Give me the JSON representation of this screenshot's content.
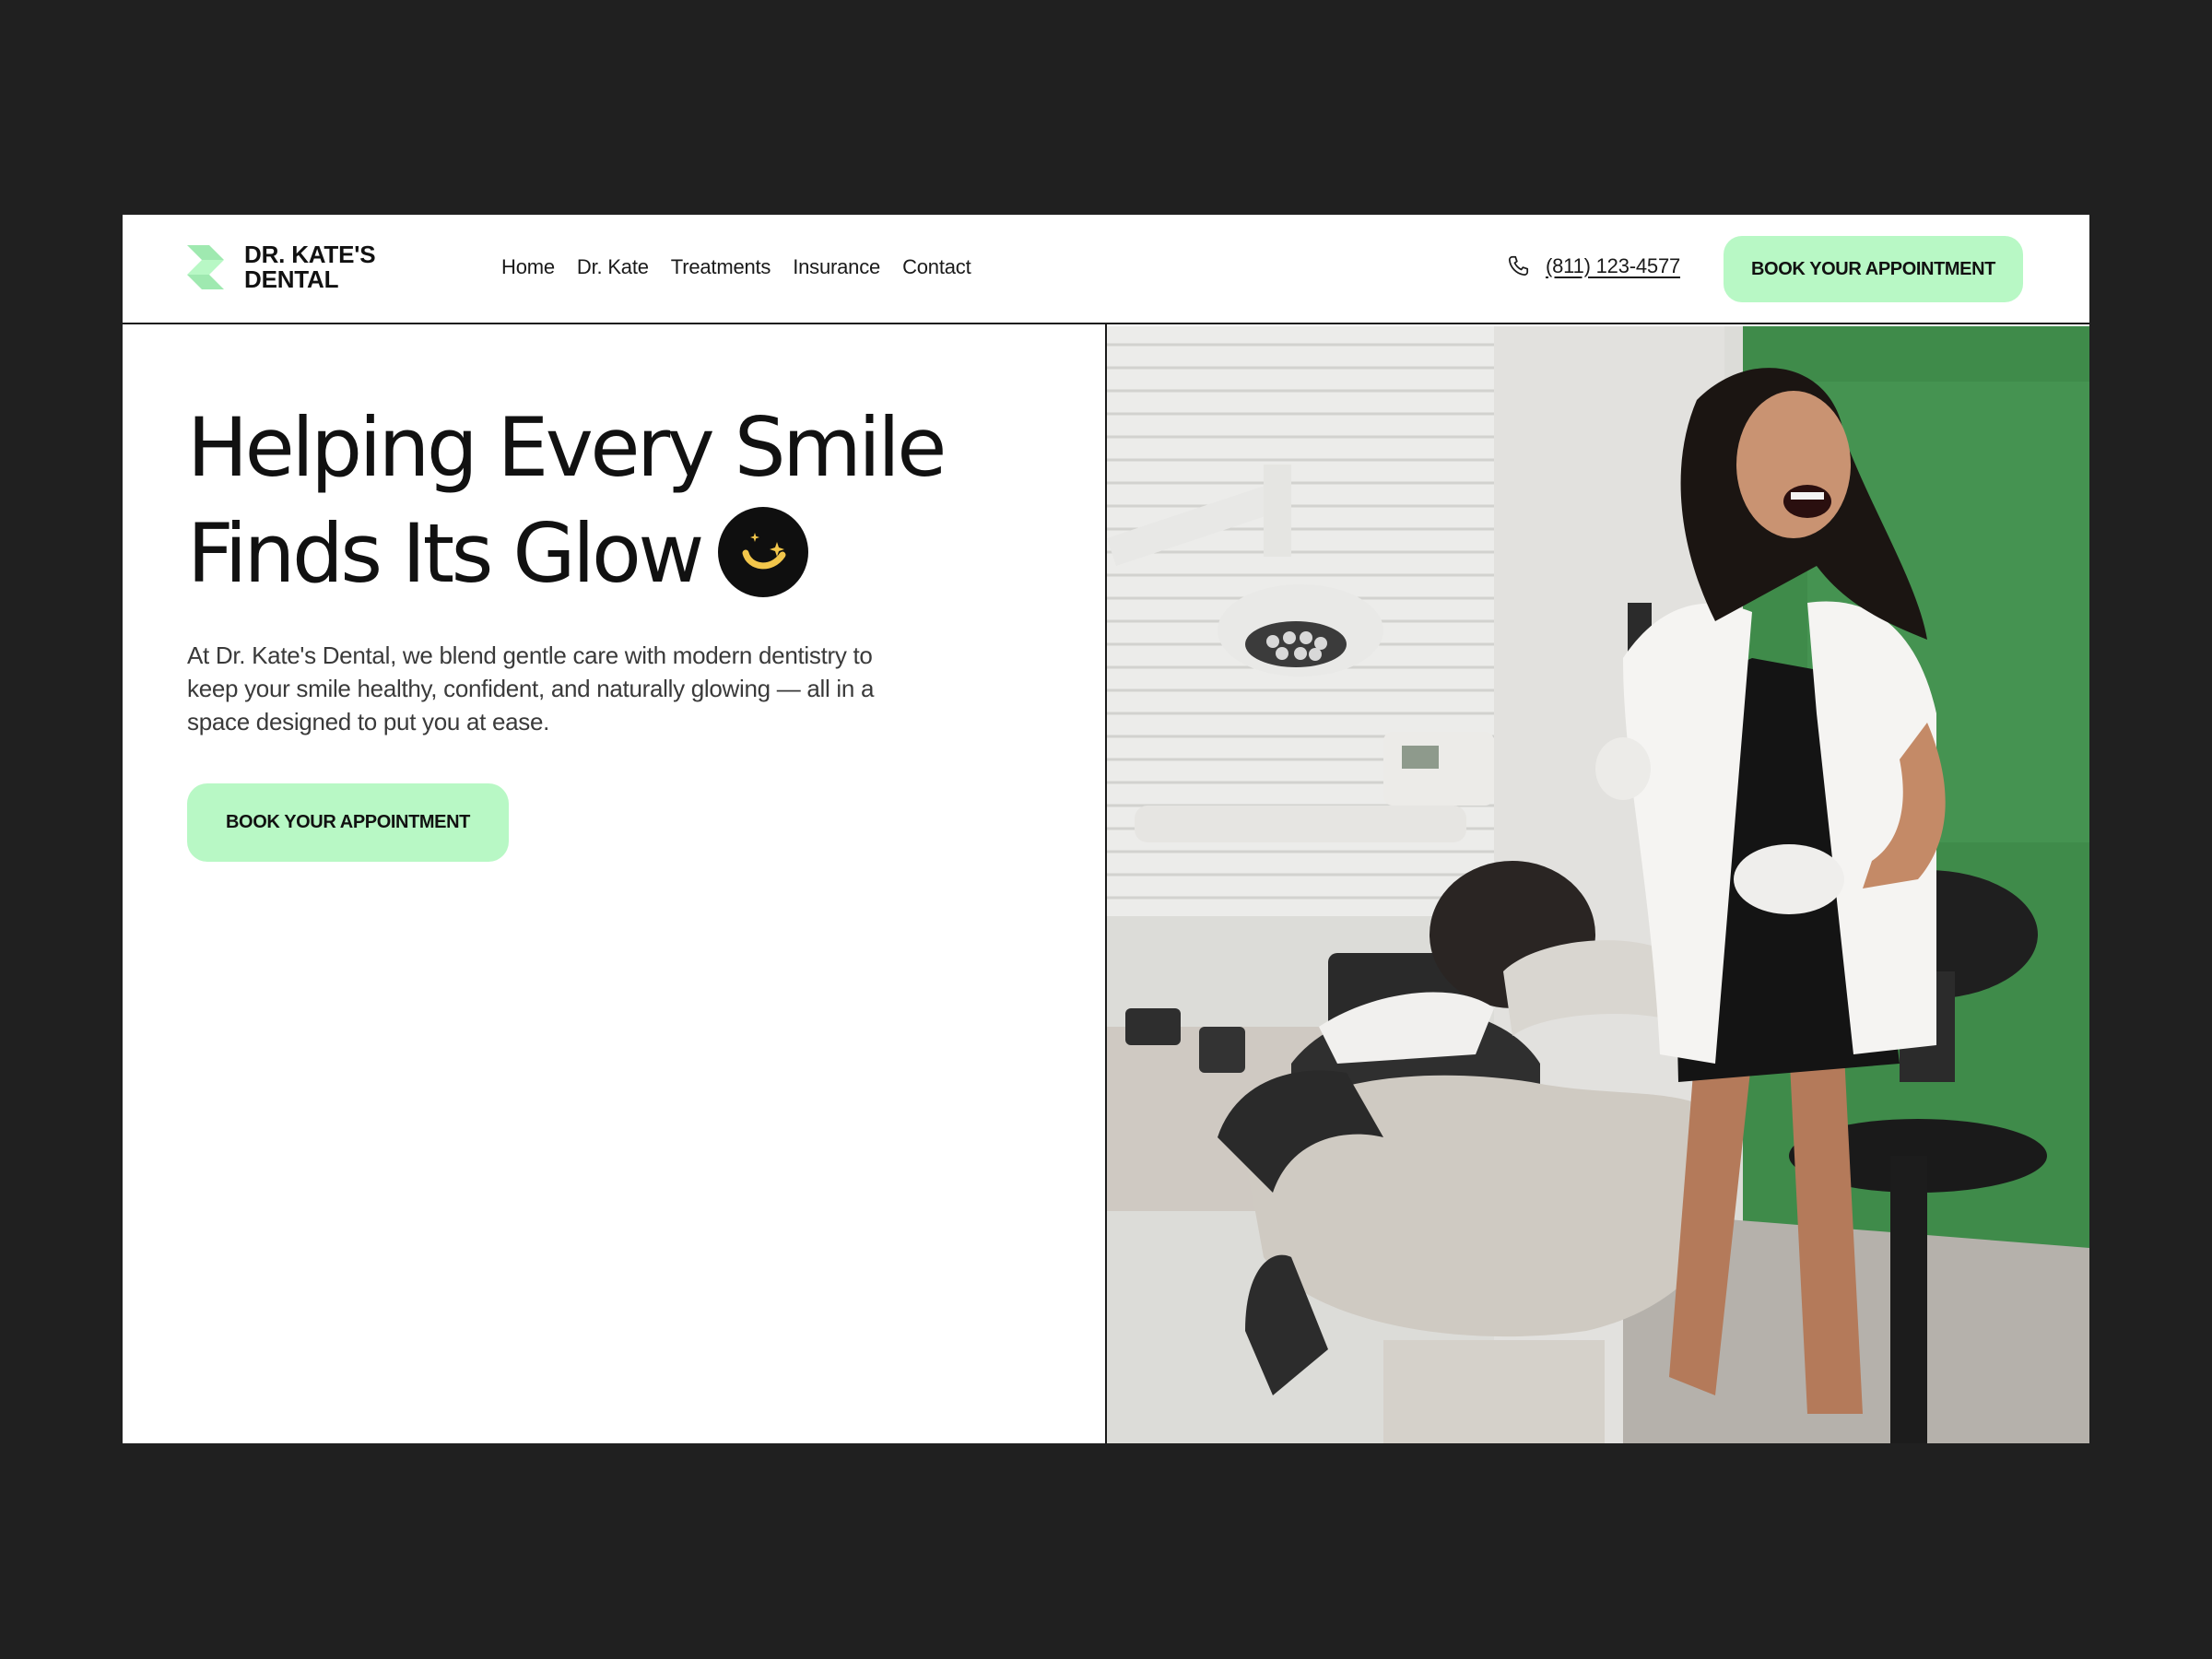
{
  "brand": {
    "name_line1": "DR. KATE'S",
    "name_line2": "DENTAL",
    "accent_color": "#b8f8c5",
    "logo_color": "#9fe9b0",
    "logo_icon": "stacked-chevron-icon"
  },
  "nav": {
    "items": [
      {
        "label": "Home"
      },
      {
        "label": "Dr. Kate"
      },
      {
        "label": "Treatments"
      },
      {
        "label": "Insurance"
      },
      {
        "label": "Contact"
      }
    ]
  },
  "header": {
    "phone_icon": "phone-icon",
    "phone": "(811) 123-4577",
    "cta_label": "BOOK YOUR APPOINTMENT"
  },
  "hero": {
    "title_line1": "Helping Every Smile",
    "title_line2": "Finds Its Glow",
    "badge_icon": "sparkle-smile-icon",
    "description": "At Dr. Kate's Dental, we blend gentle care with modern dentistry to keep your smile healthy, confident, and naturally glowing — all in a space designed to put you at ease.",
    "cta_label": "BOOK YOUR APPOINTMENT",
    "photo_subject": "dentist-with-patient-photo"
  }
}
